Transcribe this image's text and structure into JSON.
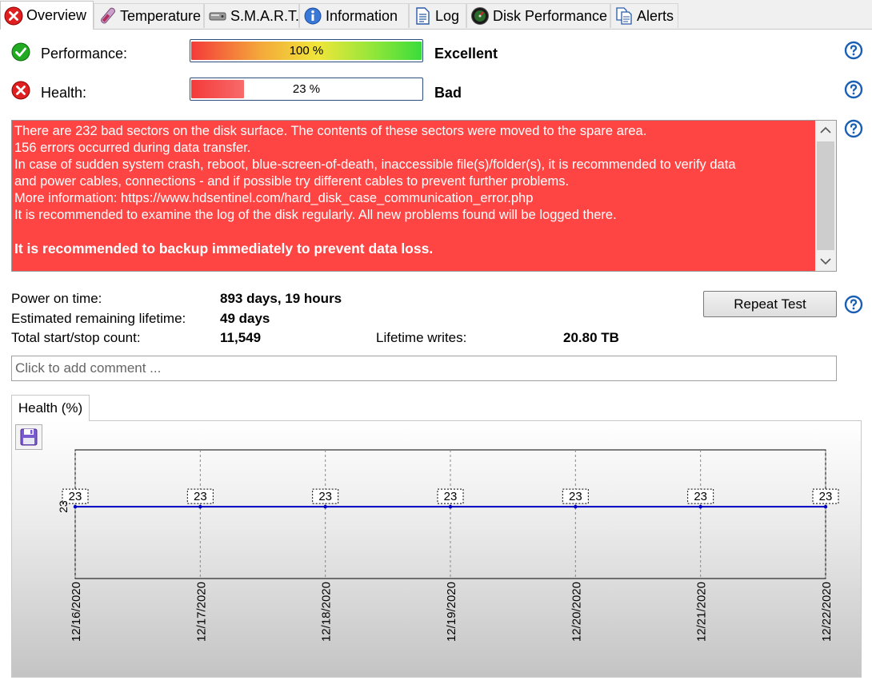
{
  "tabs": [
    {
      "label": "Overview",
      "icon": "error-icon",
      "active": true
    },
    {
      "label": "Temperature",
      "icon": "thermometer-icon",
      "active": false
    },
    {
      "label": "S.M.A.R.T.",
      "icon": "disk-icon",
      "active": false
    },
    {
      "label": "Information",
      "icon": "info-icon",
      "active": false
    },
    {
      "label": "Log",
      "icon": "document-icon",
      "active": false
    },
    {
      "label": "Disk Performance",
      "icon": "gauge-icon",
      "active": false
    },
    {
      "label": "Alerts",
      "icon": "copy-icon",
      "active": false
    }
  ],
  "performance": {
    "label": "Performance:",
    "percent": 100,
    "percent_text": "100 %",
    "rating": "Excellent"
  },
  "health": {
    "label": "Health:",
    "percent": 23,
    "percent_text": "23 %",
    "rating": "Bad"
  },
  "message": {
    "lines": [
      "There are 232 bad sectors on the disk surface. The contents of these sectors were moved to the spare area.",
      "156 errors occurred during data transfer.",
      "In case of sudden system crash, reboot, blue-screen-of-death, inaccessible file(s)/folder(s), it is recommended to verify data",
      "and power cables, connections - and if possible try different cables to prevent further problems.",
      "More information: https://www.hdsentinel.com/hard_disk_case_communication_error.php",
      "It is recommended to examine the log of the disk regularly. All new problems found will be logged there."
    ],
    "warning": "It is recommended to backup immediately to prevent data loss."
  },
  "info": {
    "power_on_label": "Power on time:",
    "power_on_value": "893 days, 19 hours",
    "remaining_label": "Estimated remaining lifetime:",
    "remaining_value": "49 days",
    "startstop_label": "Total start/stop count:",
    "startstop_value": "11,549",
    "writes_label": "Lifetime writes:",
    "writes_value": "20.80 TB"
  },
  "repeat_test_label": "Repeat Test",
  "comment_placeholder": "Click to add comment ...",
  "chart_tab_label": "Health (%)",
  "colors": {
    "message_bg": "#ff4444",
    "line": "#0000c0",
    "ok_green": "#22aa22",
    "error_red": "#e02020",
    "help_blue": "#1a5fb4"
  },
  "chart_data": {
    "type": "line",
    "x": [
      "12/16/2020",
      "12/17/2020",
      "12/18/2020",
      "12/19/2020",
      "12/20/2020",
      "12/21/2020",
      "12/22/2020"
    ],
    "values": [
      23,
      23,
      23,
      23,
      23,
      23,
      23
    ],
    "data_labels": [
      "23",
      "23",
      "23",
      "23",
      "23",
      "23",
      "23"
    ],
    "ytick_labels": [
      "23"
    ],
    "title": "",
    "xlabel": "",
    "ylabel": "",
    "ylim": [
      22,
      24
    ],
    "grid": "vertical-dashed"
  }
}
